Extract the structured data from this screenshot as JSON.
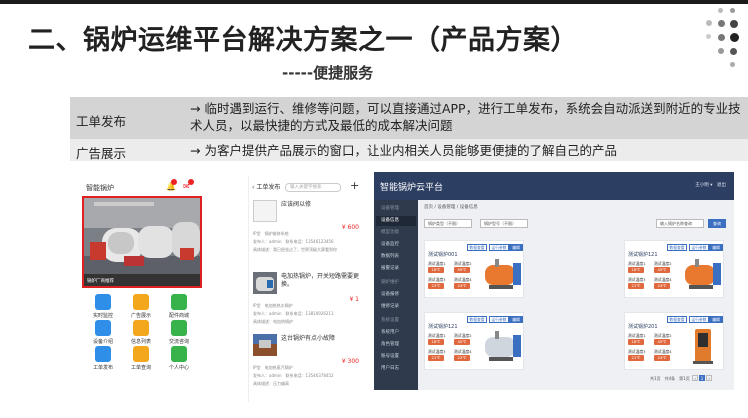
{
  "slide": {
    "title": "二、锅炉运维平台解决方案之一（产品方案）",
    "subtitle": "-----便捷服务"
  },
  "features": [
    {
      "label": "工单发布",
      "text": "→ 临时遇到运行、维修等问题，可以直接通过APP，进行工单发布，系统会自动派送到附近的专业技术人员，以最快捷的方式及最低的成本解决问题"
    },
    {
      "label": "广告展示",
      "text": "→ 为客户提供产品展示的窗口，让业内相关人员能够更便捷的了解自己的产品"
    }
  ],
  "phone_home": {
    "app_name": "智能锅炉",
    "banner_caption": "锅炉厂商推荐",
    "icons": [
      {
        "label": "实时监控",
        "color": "#2f8ee8",
        "icon": "monitor-icon"
      },
      {
        "label": "广告展示",
        "color": "#f2a71d",
        "icon": "advert-icon"
      },
      {
        "label": "配件商城",
        "color": "#38b24a",
        "icon": "shop-icon"
      },
      {
        "label": "设备介绍",
        "color": "#2f8ee8",
        "icon": "device-icon"
      },
      {
        "label": "信息列表",
        "color": "#f2a71d",
        "icon": "list-icon"
      },
      {
        "label": "交流咨询",
        "color": "#38b24a",
        "icon": "chat-icon"
      },
      {
        "label": "工单发布",
        "color": "#2f8ee8",
        "icon": "order-icon"
      },
      {
        "label": "工单查询",
        "color": "#f2a71d",
        "icon": "query-icon"
      },
      {
        "label": "个人中心",
        "color": "#38b24a",
        "icon": "user-icon"
      }
    ]
  },
  "phone_orders": {
    "back_label": "工单发布",
    "search_placeholder": "输入关键字搜索",
    "plus": "+",
    "cards": [
      {
        "title": "应该阀以修",
        "price": "¥ 600",
        "meta1": "IP型　锅炉维修系统",
        "meta2": "发布人：admin　联系电话：13546123456",
        "meta3": "具体描述：我已经坐过了，世界顶级大赛看到你"
      },
      {
        "title": "电加热锅炉，开关短路需要更换。",
        "price": "¥ 1",
        "meta1": "IP型　电加热热水锅炉",
        "meta2": "发布人：admin　联系电话：13810926211",
        "meta3": "具体描述：电加热锅炉"
      },
      {
        "title": "这台锅炉有点小故障",
        "price": "¥ 300",
        "meta1": "IP型　电加热蒸汽锅炉",
        "meta2": "发布人：admin　联系电话：13546378452",
        "meta3": "具体描述：压力偏高"
      }
    ]
  },
  "web_platform": {
    "logo": "智能锅炉云平台",
    "user": "王小明 ▾　退出",
    "breadcrumb": "首页 / 设备管理 / 设备信息",
    "filter_type": "锅炉类型（不限）",
    "filter_model": "锅炉型号（不限）",
    "filter_name": "输入锅炉名称查询",
    "filter_search": "查询",
    "sidebar": [
      "设备管理",
      "设备信息",
      "模型功能",
      "设备监控",
      "数据列表",
      "报警记录",
      "锅炉维护",
      "设备报修",
      "维修记录",
      "系统设置",
      "系统用户",
      "角色管理",
      "账号设置",
      "用户日志"
    ],
    "cards": [
      {
        "name": "测试锅炉001",
        "labels": [
          "测试温度1",
          "测试温度2",
          "测试温度3",
          "测试温度4"
        ],
        "values": [
          "18℃",
          "99℃",
          "23℃",
          "24℃"
        ]
      },
      {
        "name": "测试锅炉121",
        "labels": [
          "测试温度1",
          "测试温度2",
          "测试温度3",
          "测试温度4"
        ],
        "values": [
          "18℃",
          "45℃",
          "21℃",
          "24℃"
        ]
      },
      {
        "name": "测试锅炉121",
        "labels": [
          "测试温度1",
          "测试温度2",
          "测试温度3",
          "测试温度4"
        ],
        "values": [
          "18℃",
          "40℃",
          "21℃",
          "23℃"
        ]
      },
      {
        "name": "测试锅炉201",
        "labels": [
          "测试温度1",
          "测试温度2",
          "测试温度3",
          "测试温度4"
        ],
        "values": [
          "18℃",
          "45℃",
          "21℃",
          "24℃"
        ]
      }
    ],
    "card_buttons": [
      "数据查看",
      "运行参数",
      "编辑"
    ],
    "pager": "共1页　共4条　第1页"
  },
  "colors": {
    "accent": "#3b6fc2",
    "sidebar": "#2f3b4d",
    "header": "#2d3e63",
    "highlight": "#e02020"
  }
}
